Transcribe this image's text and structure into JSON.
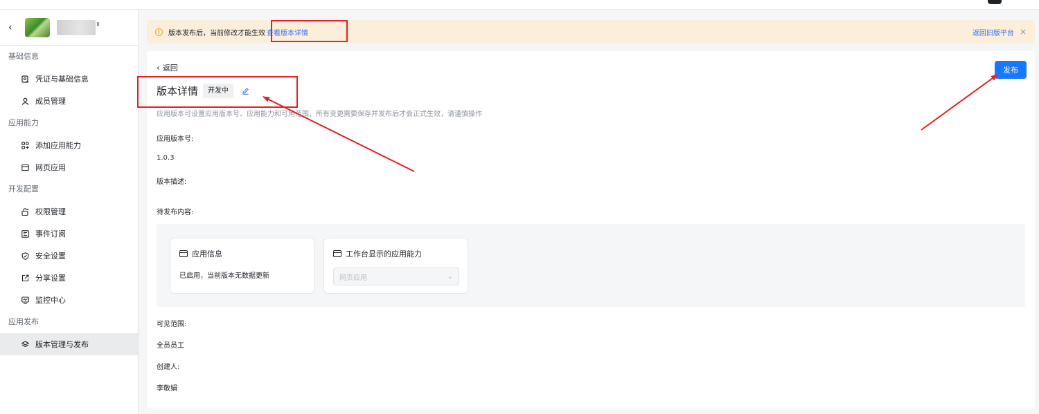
{
  "sidebar": {
    "groups": [
      {
        "title": "基础信息",
        "items": [
          {
            "label": "凭证与基础信息",
            "icon": "credential-icon"
          },
          {
            "label": "成员管理",
            "icon": "user-icon"
          }
        ]
      },
      {
        "title": "应用能力",
        "items": [
          {
            "label": "添加应用能力",
            "icon": "apps-icon"
          },
          {
            "label": "网页应用",
            "icon": "window-icon"
          }
        ]
      },
      {
        "title": "开发配置",
        "items": [
          {
            "label": "权限管理",
            "icon": "lock-icon"
          },
          {
            "label": "事件订阅",
            "icon": "event-icon"
          },
          {
            "label": "安全设置",
            "icon": "shield-icon"
          },
          {
            "label": "分享设置",
            "icon": "share-icon"
          },
          {
            "label": "监控中心",
            "icon": "monitor-icon"
          }
        ]
      },
      {
        "title": "应用发布",
        "items": [
          {
            "label": "版本管理与发布",
            "icon": "layers-icon",
            "active": true
          }
        ]
      }
    ]
  },
  "notice": {
    "text": "版本发布后，当前修改才能生效",
    "link": "查看版本详情",
    "back_label": "返回旧版平台",
    "close_symbol": "×"
  },
  "main": {
    "back_label": "返回",
    "publish_label": "发布",
    "title": "版本详情",
    "status": "开发中",
    "description": "应用版本可设置应用版本号、应用能力和可用范围，所有变更需要保存并发布后才会正式生效，请谨慎操作",
    "version_label": "应用版本号:",
    "version_value": "1.0.3",
    "desc_label": "版本描述:",
    "pending_label": "待发布内容:",
    "app_info_card": {
      "title": "应用信息",
      "body": "已启用，当前版本无数据更新"
    },
    "workbench_card": {
      "title": "工作台显示的应用能力",
      "select_value": "网页应用"
    },
    "scope_label": "可见范围:",
    "scope_value": "全员员工",
    "creator_label": "创建人:",
    "creator_value": "李敬娟"
  },
  "colors": {
    "primary": "#1677ff",
    "link": "#3370ff",
    "notice_bg": "#fbefdc",
    "annotation": "#ee1c1c"
  }
}
